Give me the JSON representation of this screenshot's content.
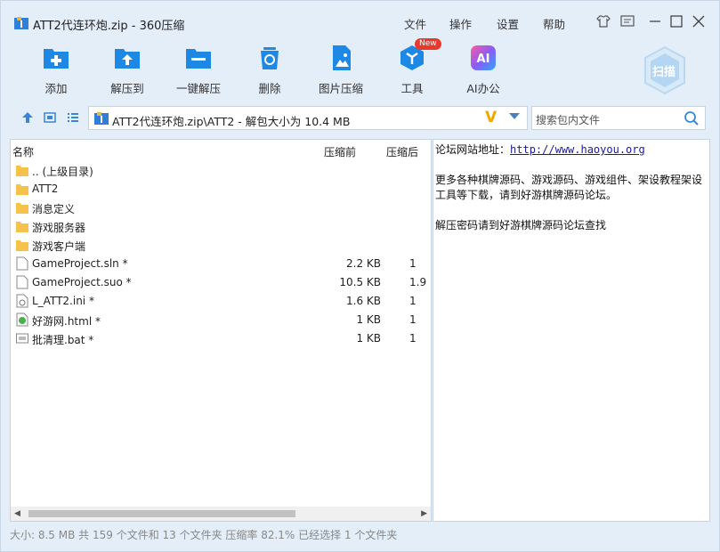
{
  "window": {
    "title": "ATT2代连环炮.zip - 360压缩",
    "menus": [
      "文件",
      "操作",
      "设置",
      "帮助"
    ]
  },
  "toolbar": {
    "add": "添加",
    "extract_to": "解压到",
    "one_click": "一键解压",
    "delete": "删除",
    "image_compress": "图片压缩",
    "tools": "工具",
    "tools_badge": "New",
    "ai_office": "AI办公",
    "ai_icon_text": "AI",
    "scan": "扫描"
  },
  "address": {
    "path": "ATT2代连环炮.zip\\ATT2 - 解包大小为 10.4 MB",
    "v_mark": "V"
  },
  "search": {
    "placeholder": "搜索包内文件"
  },
  "file_list": {
    "columns": {
      "name": "名称",
      "before": "压缩前",
      "after": "压缩后"
    },
    "rows": [
      {
        "name": ".. (上级目录)",
        "size": "",
        "ratio": "",
        "icon": "folder-icon"
      },
      {
        "name": "ATT2",
        "size": "",
        "ratio": "",
        "icon": "folder-icon"
      },
      {
        "name": "消息定义",
        "size": "",
        "ratio": "",
        "icon": "folder-icon"
      },
      {
        "name": "游戏服务器",
        "size": "",
        "ratio": "",
        "icon": "folder-icon"
      },
      {
        "name": "游戏客户端",
        "size": "",
        "ratio": "",
        "icon": "folder-icon"
      },
      {
        "name": "GameProject.sln *",
        "size": "2.2 KB",
        "ratio": "1",
        "icon": "file-icon"
      },
      {
        "name": "GameProject.suo *",
        "size": "10.5 KB",
        "ratio": "1.9",
        "icon": "file-icon"
      },
      {
        "name": "L_ATT2.ini *",
        "size": "1.6 KB",
        "ratio": "1",
        "icon": "ini-icon"
      },
      {
        "name": "好游网.html *",
        "size": "1 KB",
        "ratio": "1",
        "icon": "html-icon"
      },
      {
        "name": "批清理.bat *",
        "size": "1 KB",
        "ratio": "1",
        "icon": "bat-icon"
      }
    ]
  },
  "comment": {
    "line1_label": "论坛网站地址：",
    "line1_link": "http://www.haoyou.org",
    "line2": "更多各种棋牌源码、游戏源码、游戏组件、架设教程架设工具等下载，请到好游棋牌源码论坛。",
    "line3": "解压密码请到好游棋牌源码论坛查找"
  },
  "status": "大小: 8.5 MB 共 159 个文件和 13 个文件夹 压缩率 82.1% 已经选择 1 个文件夹",
  "colors": {
    "accent": "#1e88e5",
    "background": "#e4eef9",
    "badge": "#e83a2a",
    "v_mark": "#f0a800"
  }
}
